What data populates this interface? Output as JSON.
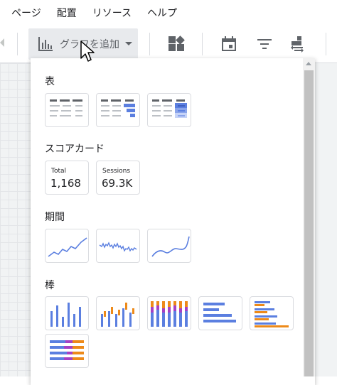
{
  "menu": [
    "ページ",
    "配置",
    "リソース",
    "ヘルプ"
  ],
  "toolbar": {
    "add_chart_label": "グラフを追加"
  },
  "sections": {
    "table": {
      "title": "表"
    },
    "scorecard": {
      "title": "スコアカード",
      "cards": [
        {
          "label": "Total",
          "value": "1,168"
        },
        {
          "label": "Sessions",
          "value": "69.3K"
        }
      ]
    },
    "timeseries": {
      "title": "期間"
    },
    "bar": {
      "title": "棒"
    }
  },
  "colors": {
    "blue": "#5b7fe0",
    "orange": "#ed8a1a",
    "purple": "#a540c4",
    "light_blue": "#c6d3f7",
    "gray": "#9aa0a6"
  }
}
